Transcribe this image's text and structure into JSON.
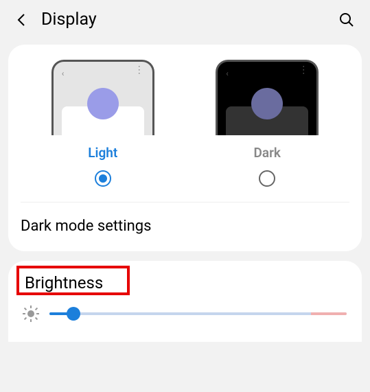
{
  "header": {
    "title": "Display"
  },
  "theme": {
    "options": [
      {
        "label": "Light",
        "selected": true
      },
      {
        "label": "Dark",
        "selected": false
      }
    ],
    "dark_mode_settings_label": "Dark mode settings"
  },
  "brightness": {
    "title": "Brightness",
    "value_percent": 8
  }
}
